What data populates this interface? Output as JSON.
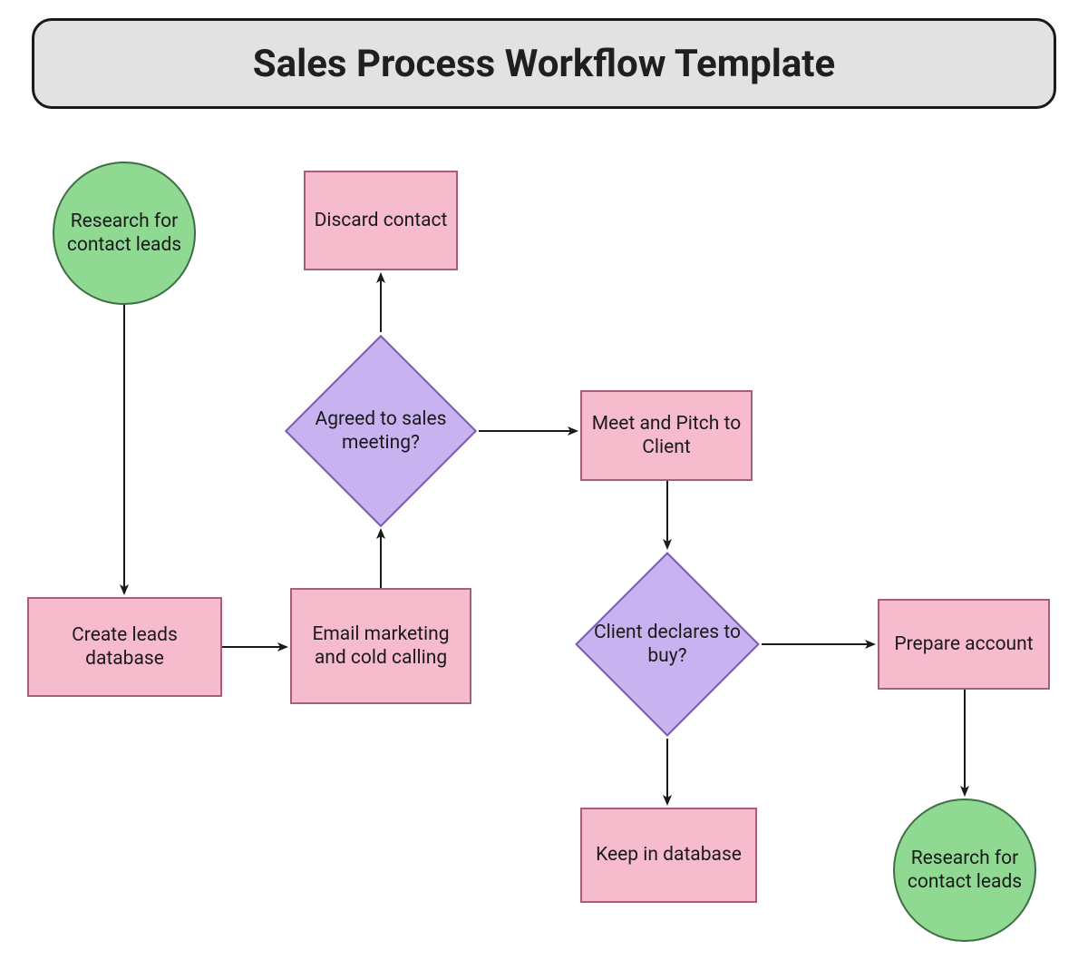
{
  "title": "Sales Process Workflow Template",
  "nodes": {
    "start_circle": "Research for contact leads",
    "discard": "Discard contact",
    "create_db": "Create leads database",
    "email": "Email marketing and cold calling",
    "agree_meeting": "Agreed to sales meeting?",
    "meet_pitch": "Meet and Pitch to Client",
    "client_buy": "Client declares to buy?",
    "prepare": "Prepare account",
    "keep_db": "Keep in database",
    "end_circle": "Research for contact leads"
  },
  "colors": {
    "title_bg": "#e2e2e2",
    "circle_fill": "#90d993",
    "rect_fill": "#f7bbce",
    "diamond_fill": "#c8b3f0"
  }
}
